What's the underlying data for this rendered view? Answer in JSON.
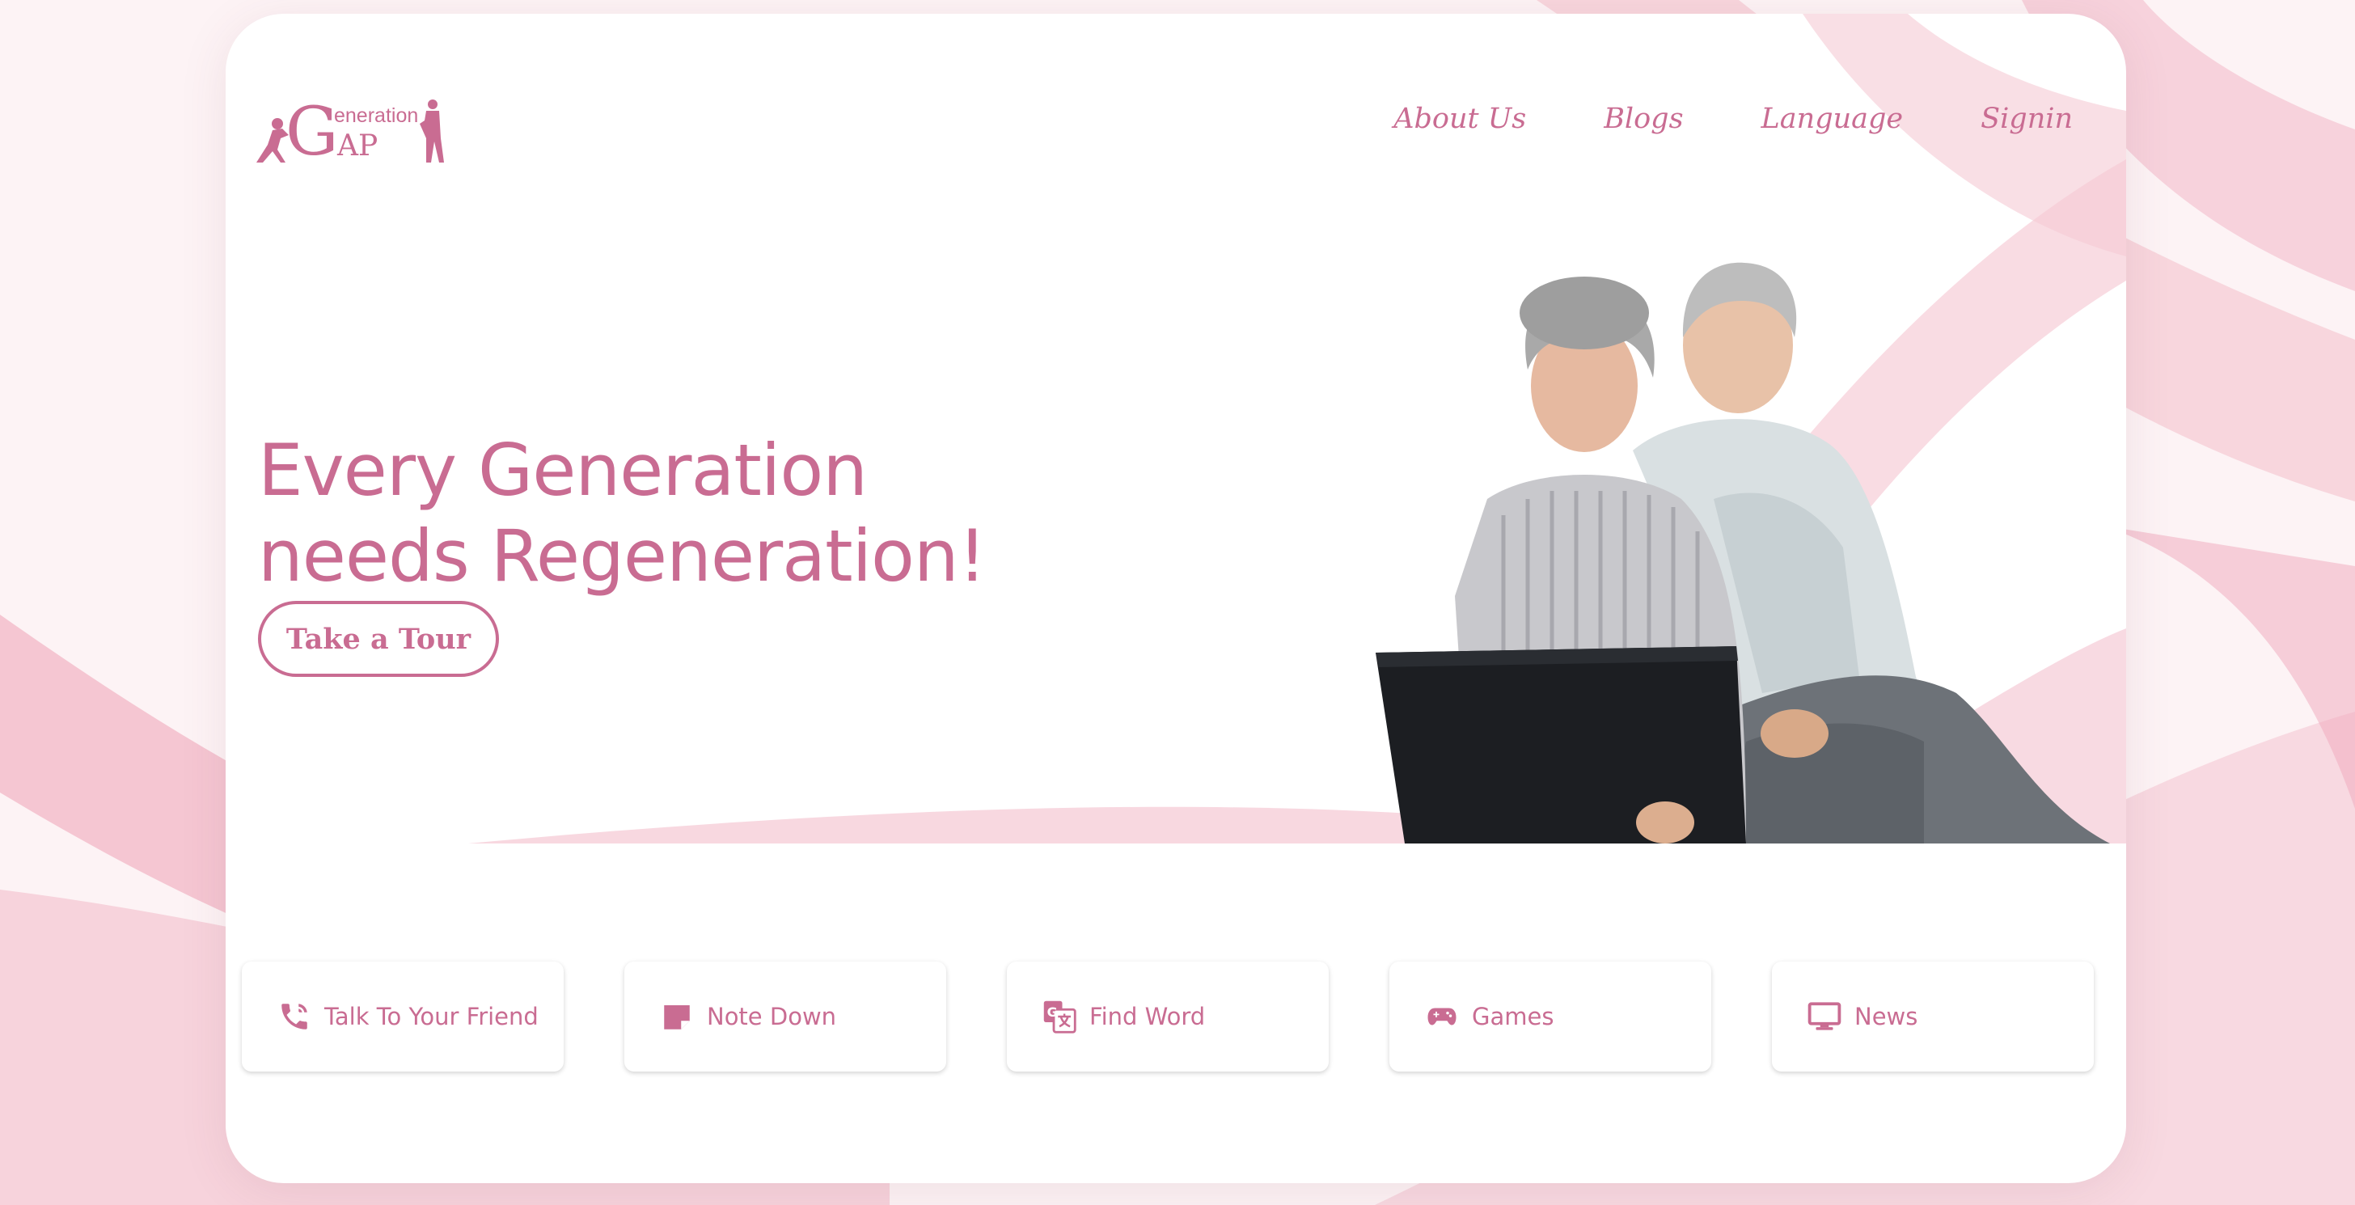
{
  "brand": {
    "logo_big_g": "G",
    "logo_top": "eneration",
    "logo_bottom": "AP",
    "accent": "#c96c92",
    "bg_wave": "#f2b8c6"
  },
  "nav": {
    "items": [
      {
        "label": "About Us"
      },
      {
        "label": "Blogs"
      },
      {
        "label": "Language"
      },
      {
        "label": "Signin"
      }
    ]
  },
  "hero": {
    "title_line1": "Every Generation",
    "title_line2": "needs Regeneration!",
    "cta_label": "Take a Tour",
    "image_desc_icon": "elderly-couple-laptop-photo"
  },
  "features": [
    {
      "label": "Talk To Your Friend",
      "icon": "phone-icon"
    },
    {
      "label": "Note Down",
      "icon": "note-icon"
    },
    {
      "label": "Find Word",
      "icon": "translate-icon"
    },
    {
      "label": "Games",
      "icon": "gamepad-icon"
    },
    {
      "label": "News",
      "icon": "monitor-icon"
    }
  ]
}
